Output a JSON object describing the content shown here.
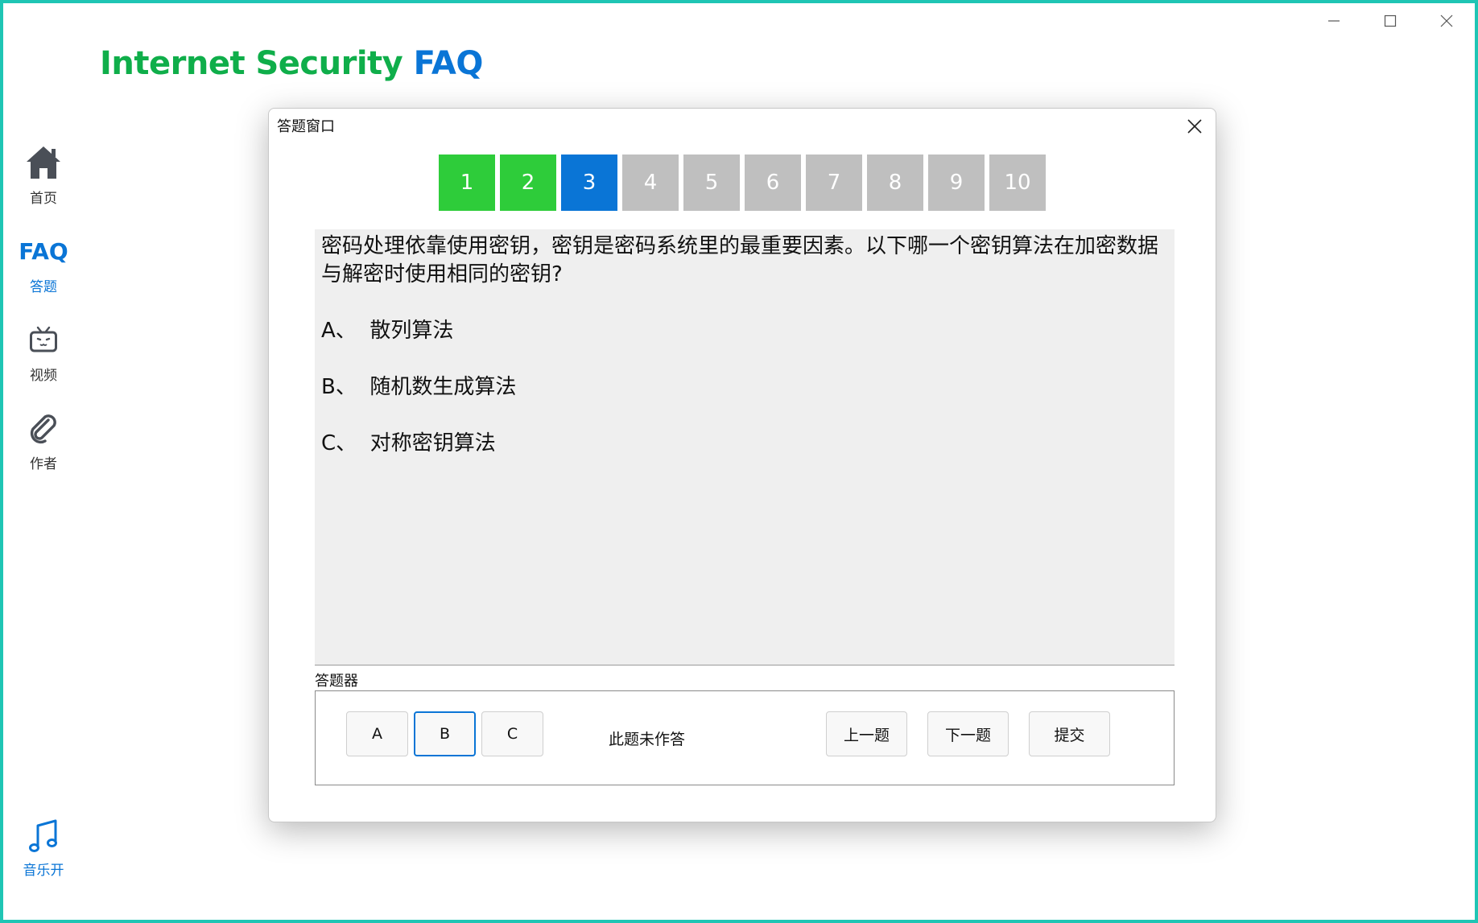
{
  "app": {
    "title_part1": "Internet Security ",
    "title_part2": "FAQ",
    "title_color_1": "#0fae4a",
    "title_color_2": "#0a75d6"
  },
  "sidebar": {
    "items": [
      {
        "label": "首页",
        "icon": "home-icon"
      },
      {
        "label": "答题",
        "icon_text": "FAQ"
      },
      {
        "label": "视频",
        "icon": "tv-icon"
      },
      {
        "label": "作者",
        "icon": "paperclip-icon"
      }
    ],
    "music": {
      "label": "音乐开",
      "icon": "music-note-icon"
    }
  },
  "dialog": {
    "title": "答题窗口",
    "question_numbers": [
      {
        "label": "1",
        "state": "done"
      },
      {
        "label": "2",
        "state": "done"
      },
      {
        "label": "3",
        "state": "current"
      },
      {
        "label": "4",
        "state": "todo"
      },
      {
        "label": "5",
        "state": "todo"
      },
      {
        "label": "6",
        "state": "todo"
      },
      {
        "label": "7",
        "state": "todo"
      },
      {
        "label": "8",
        "state": "todo"
      },
      {
        "label": "9",
        "state": "todo"
      },
      {
        "label": "10",
        "state": "todo"
      }
    ],
    "question": "密码处理依靠使用密钥，密钥是密码系统里的最重要因素。以下哪一个密钥算法在加密数据与解密时使用相同的密钥?",
    "options": [
      {
        "prefix": "A、",
        "text": "散列算法"
      },
      {
        "prefix": "B、",
        "text": "随机数生成算法"
      },
      {
        "prefix": "C、",
        "text": "对称密钥算法"
      }
    ],
    "answer_group_label": "答题器",
    "answer_buttons": [
      "A",
      "B",
      "C"
    ],
    "status": "此题未作答",
    "prev_label": "上一题",
    "next_label": "下一题",
    "submit_label": "提交"
  }
}
